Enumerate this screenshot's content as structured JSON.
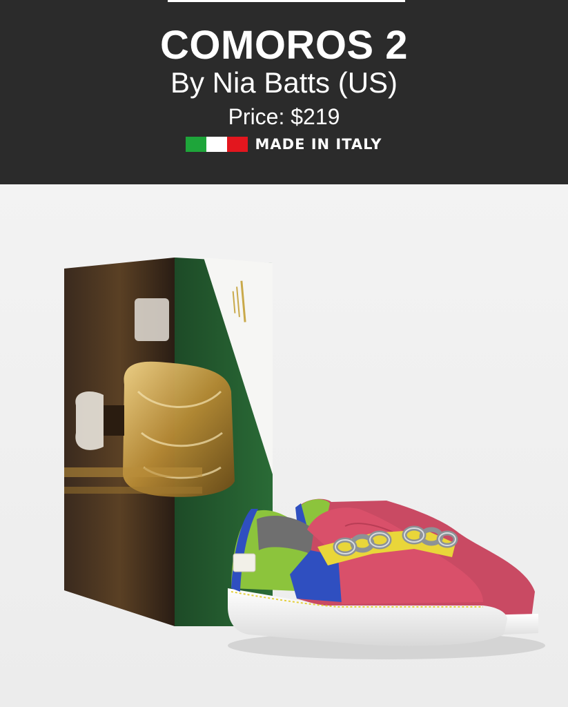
{
  "product": {
    "title": "COMOROS 2",
    "designer": "By Nia Batts (US)",
    "price": "Price: $219",
    "origin": "MADE IN ITALY"
  },
  "colors": {
    "header_bg": "#2b2b2b",
    "flag_green": "#1ea53a",
    "flag_white": "#ffffff",
    "flag_red": "#e3161e",
    "shoe_pink": "#d9506a",
    "shoe_lime": "#8cc43c",
    "shoe_blue": "#2f4fc0",
    "shoe_yellow": "#e9d63a",
    "box_green": "#1f5a2c"
  }
}
